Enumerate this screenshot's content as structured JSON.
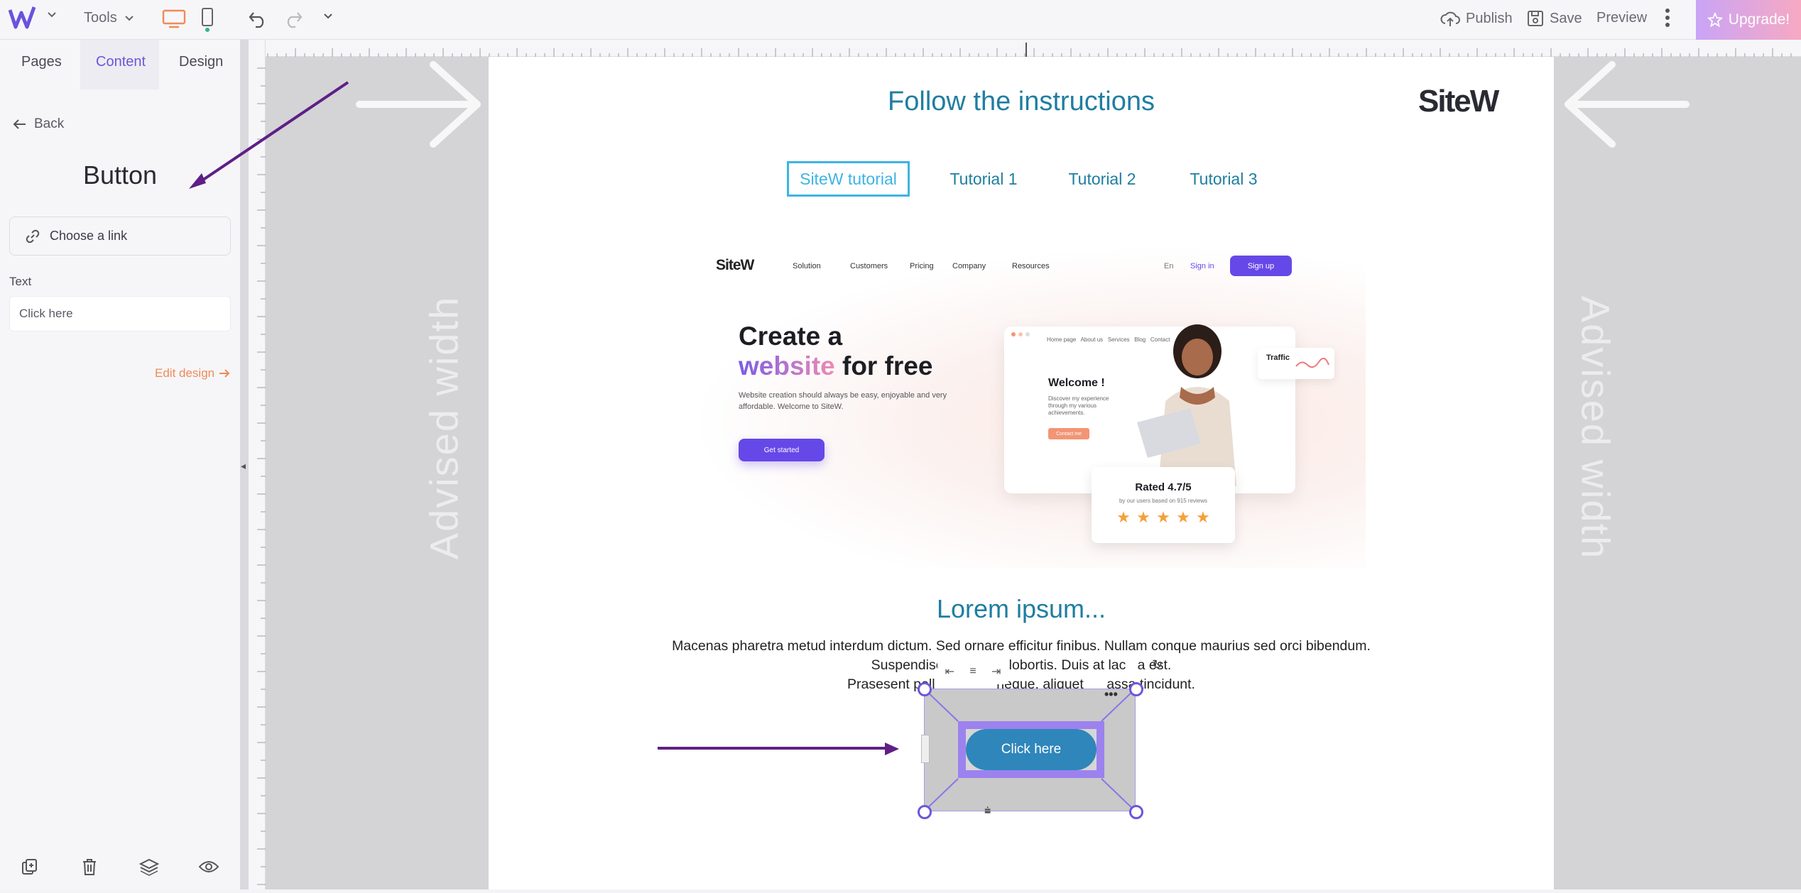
{
  "topbar": {
    "tools_label": "Tools",
    "publish_label": "Publish",
    "save_label": "Save",
    "preview_label": "Preview",
    "upgrade_label": "Upgrade!",
    "accent_color": "#f08a57"
  },
  "left_panel": {
    "tabs": [
      {
        "label": "Pages"
      },
      {
        "label": "Content",
        "active": true
      },
      {
        "label": "Design"
      }
    ],
    "back_label": "Back",
    "title": "Button",
    "link_placeholder": "Choose a link",
    "text_label": "Text",
    "text_value": "Click here",
    "edit_design_label": "Edit design"
  },
  "canvas": {
    "advised_width_label": "Advised width",
    "page_title": "Follow the instructions",
    "brand_logo": "SiteW",
    "tutorials": [
      {
        "label": "SiteW tutorial",
        "active": true
      },
      {
        "label": "Tutorial 1"
      },
      {
        "label": "Tutorial 2"
      },
      {
        "label": "Tutorial 3"
      }
    ],
    "hero": {
      "logo": "SiteW",
      "nav": [
        "Solution",
        "Customers",
        "Pricing",
        "Company",
        "Resources"
      ],
      "lang": "En",
      "signin": "Sign in",
      "signup": "Sign up",
      "headline_line1": "Create a",
      "headline_highlight": "website",
      "headline_rest": " for free",
      "subtext": "Website creation should always be easy, enjoyable and very affordable. Welcome to SiteW.",
      "cta": "Get started",
      "mock_nav": [
        "Home page",
        "About us",
        "Services",
        "Blog",
        "Contact"
      ],
      "welcome": "Welcome !",
      "welcome_sub": "Discover my experience through my various achievements.",
      "contact_btn": "Contact me",
      "traffic": "Traffic",
      "rated_title": "Rated 4.7/5",
      "rated_sub": "by our users based on 915 reviews",
      "stars": 5
    },
    "lorem_title": "Lorem ipsum...",
    "lorem_lines": [
      "Macenas pharetra metud interdum dictum. Sed ornare efficitur finibus. Nullam conque maurius sed orci bibendum.",
      "Suspendise f            a lobortis. Duis at lac   a est.",
      "Prasesent pell                neque, aliquet      assa tincidunt."
    ],
    "button_label": "Click here",
    "annotation_color": "#5f1f86",
    "selection_color": "#6d55dd"
  }
}
